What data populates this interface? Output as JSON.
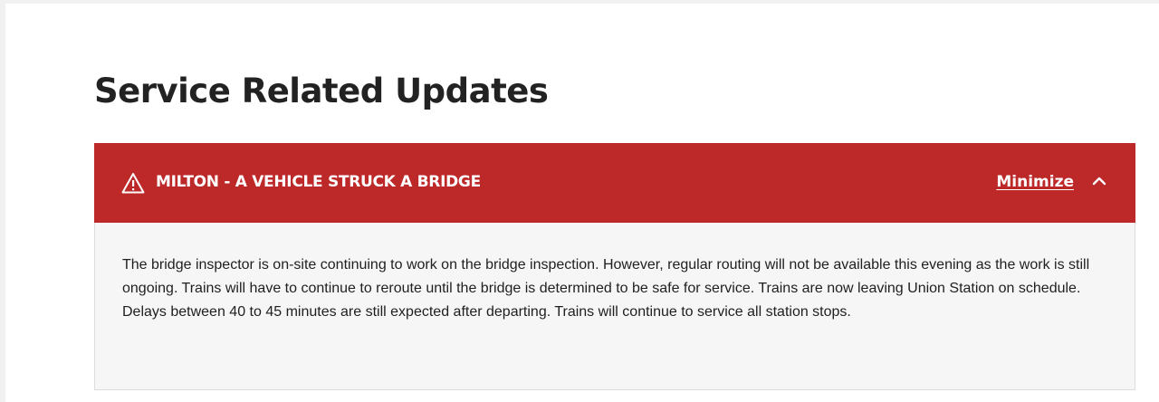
{
  "page": {
    "title": "Service Related Updates"
  },
  "alert": {
    "icon": "warning-triangle-icon",
    "title": "MILTON - A VEHICLE STRUCK A BRIDGE",
    "minimize_label": "Minimize",
    "toggle_icon": "chevron-up-icon",
    "body": "The bridge inspector is on-site continuing to work on the bridge inspection. However, regular routing will not be available this evening as the work is still ongoing. Trains will have to continue to reroute until the bridge is determined to be safe for service. Trains are now leaving Union Station on schedule. Delays between 40 to 45 minutes are still expected after departing. Trains will continue to service all station stops.",
    "colors": {
      "header_background": "#bd2829",
      "header_text": "#ffffff",
      "body_background": "#f6f6f6"
    }
  }
}
